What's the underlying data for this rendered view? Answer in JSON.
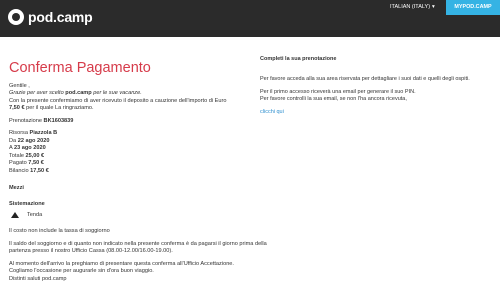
{
  "header": {
    "logo_text": "pod.camp",
    "language": "ITALIAN (ITALY)",
    "language_caret": "▾",
    "mypodcamp_button": "MYPOD.CAMP"
  },
  "main": {
    "title": "Conferma Pagamento",
    "greeting": "Gentile ,",
    "thanks_pre": "Grazie per aver scelto ",
    "thanks_brand": "pod.camp",
    "thanks_post": " per le sue vacanze.",
    "confirm_text": "Con la presente confermiamo di aver ricevuto il deposito a cauzione dell'importo di Euro",
    "deposit_amount": "7,50 €",
    "confirm_tail": " per il quale La ringraziamo.",
    "booking_label": "Prenotazione ",
    "booking_code": "BK1603839",
    "resource_label": "Risorsa ",
    "resource_value": "Piazzola B",
    "from_label": "Da ",
    "from_value": "22 ago 2020",
    "to_label": "A ",
    "to_value": "23 ago 2020",
    "total_label": "Totale ",
    "total_value": "25,00 €",
    "paid_label": "Pagato ",
    "paid_value": "7,50 €",
    "balance_label": "Bilancio ",
    "balance_value": "17,50 €",
    "means_heading": "Mezzi",
    "accommodation_heading": "Sistemazione",
    "accommodation_item": "Tenda",
    "tax_note": "Il costo non include la tassa di soggiorno",
    "balance_note": "Il saldo del soggiorno e di quanto non indicato nella presente conferma è da pagarsi il giorno prima della partenza presso il nostro Ufficio Cassa (08.00-12.00/16.00-19.00).",
    "arrival_note": "Al momento dell'arrivo la preghiamo di presentare questa conferma all'Ufficio Accettazione.",
    "closing": "Cogliamo l'occasione per augurarle sin d'ora buon viaggio.",
    "signature": "Distinti saluti pod.camp"
  },
  "aside": {
    "heading": "Completi la sua prenotazione",
    "paragraph1": "Per favore acceda alla sua area riservata per dettagliare i suoi dati e quelli degli ospiti.",
    "paragraph2a": "Per il primo accesso riceverà una email per generare il suo PIN.",
    "paragraph2b": "Per favore controlli la sua email, se non l'ha ancora ricevuta,",
    "link": "clicchi qui"
  }
}
